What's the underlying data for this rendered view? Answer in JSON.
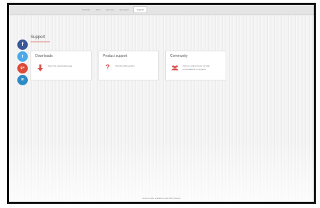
{
  "nav": {
    "items": [
      "Products",
      "Store",
      "Services",
      "Education",
      "Support"
    ],
    "active_index": 4
  },
  "social": {
    "facebook_label": "f",
    "twitter_label": "t",
    "googleplus_label": "g+",
    "linkedin_label": "in"
  },
  "page": {
    "title": "Support"
  },
  "cards": [
    {
      "title": "Downloads",
      "text": "Open the downloads page",
      "icon": "download-arrow-icon"
    },
    {
      "title": "Product support",
      "text": "Visit the FAQ section",
      "icon": "question-mark-icon"
    },
    {
      "title": "Community",
      "text": "Visit our online forum for help, conversations or projects",
      "icon": "people-icon"
    }
  ],
  "card_icon_glyphs": {
    "question": "?"
  },
  "footer": {
    "text": "Source code available under GPL license"
  },
  "colors": {
    "accent": "#d9534f",
    "facebook": "#3b5998",
    "twitter": "#4aa9e6",
    "googleplus": "#dd4b39",
    "linkedin": "#2c8bc4"
  }
}
